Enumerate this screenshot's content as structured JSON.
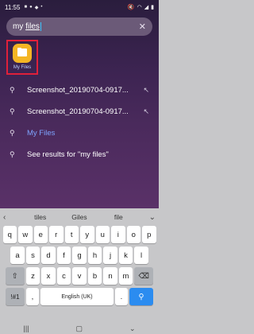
{
  "status": {
    "time": "11:55"
  },
  "search": {
    "query": "my files",
    "query_plain": "my ",
    "query_underlined": "files"
  },
  "app": {
    "label": "My Files"
  },
  "results": [
    {
      "text": "Screenshot_20190704-0917...",
      "type": "file"
    },
    {
      "text": "Screenshot_20190704-0917...",
      "type": "file"
    },
    {
      "text": "My Files",
      "type": "highlight"
    },
    {
      "text": "See results for \"my files\"",
      "type": "search"
    }
  ],
  "keyboard": {
    "predictions": [
      "tiles",
      "Giles",
      "file"
    ],
    "row1": [
      "q",
      "w",
      "e",
      "r",
      "t",
      "y",
      "u",
      "i",
      "o",
      "p"
    ],
    "row2": [
      "a",
      "s",
      "d",
      "f",
      "g",
      "h",
      "j",
      "k",
      "l"
    ],
    "row3": [
      "z",
      "x",
      "c",
      "v",
      "b",
      "n",
      "m"
    ],
    "sym_label": "!#1",
    "comma_label": ",",
    "space_label": "English (UK)",
    "period_label": "."
  }
}
